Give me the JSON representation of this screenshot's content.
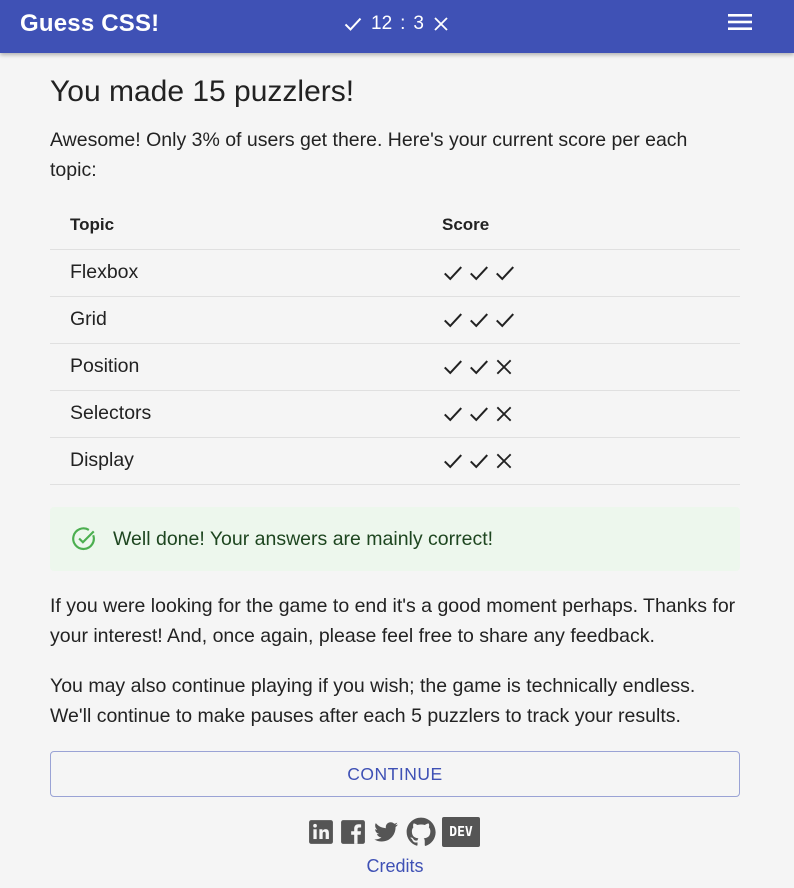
{
  "app": {
    "title": "Guess CSS!",
    "accent_color": "#3f51b5",
    "score": {
      "correct": 12,
      "separator": ":",
      "wrong": 3,
      "correct_icon": "check-icon",
      "wrong_icon": "close-icon"
    },
    "menu_icon": "menu-icon"
  },
  "main": {
    "title": "You made 15 puzzlers!",
    "intro": "Awesome! Only 3% of users get there. Here's your current score per each topic:",
    "table": {
      "headers": [
        "Topic",
        "Score"
      ],
      "rows": [
        {
          "topic": "Flexbox",
          "results": [
            "correct",
            "correct",
            "correct"
          ]
        },
        {
          "topic": "Grid",
          "results": [
            "correct",
            "correct",
            "correct"
          ]
        },
        {
          "topic": "Position",
          "results": [
            "correct",
            "correct",
            "wrong"
          ]
        },
        {
          "topic": "Selectors",
          "results": [
            "correct",
            "correct",
            "wrong"
          ]
        },
        {
          "topic": "Display",
          "results": [
            "correct",
            "correct",
            "wrong"
          ]
        }
      ]
    },
    "alert": {
      "icon": "check-circle-icon",
      "text": "Well done! Your answers are mainly correct!",
      "background_color": "#edf7ed",
      "icon_color": "#4caf50"
    },
    "paragraph1": "If you were looking for the game to end it's a good moment perhaps. Thanks for your interest! And, once again, please feel free to share any feedback.",
    "paragraph2": "You may also continue playing if you wish; the game is technically endless. We'll continue to make pauses after each 5 puzzlers to track your results.",
    "continue_label": "CONTINUE"
  },
  "footer": {
    "social_icons": [
      "linkedin-icon",
      "facebook-icon",
      "twitter-icon",
      "github-icon",
      "dev-icon"
    ],
    "dev_label": "DEV",
    "credits": "Credits"
  }
}
